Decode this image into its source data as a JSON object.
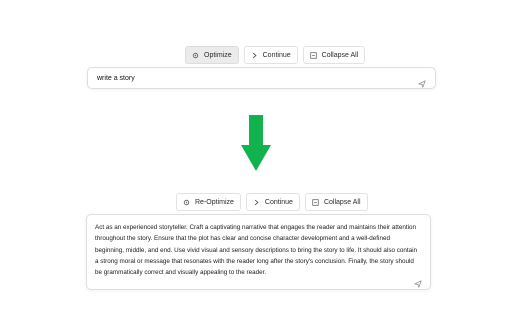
{
  "toolbar_top": {
    "optimize_label": "Optimize",
    "continue_label": "Continue",
    "collapse_label": "Collapse All"
  },
  "input_top": {
    "text": "write a story"
  },
  "toolbar_bottom": {
    "reoptimize_label": "Re-Optimize",
    "continue_label": "Continue",
    "collapse_label": "Collapse All"
  },
  "output": {
    "text": "Act as an experienced storyteller. Craft a captivating narrative that engages the reader and maintains their attention throughout the story. Ensure that the plot has clear and concise character development and a well-defined beginning, middle, and end. Use vivid visual and sensory descriptions to bring the story to life. It should also contain a strong moral or message that resonates with the reader long after the story's conclusion. Finally, the story should be grammatically correct and visually appealing to the reader."
  },
  "colors": {
    "arrow": "#12b24f",
    "active_button_bg": "#ebebeb",
    "border": "#dedede"
  },
  "icons": {
    "optimize": "gear-icon",
    "continue": "chevron-right-icon",
    "collapse": "collapse-icon",
    "send": "send-icon",
    "arrow": "arrow-down-icon"
  }
}
